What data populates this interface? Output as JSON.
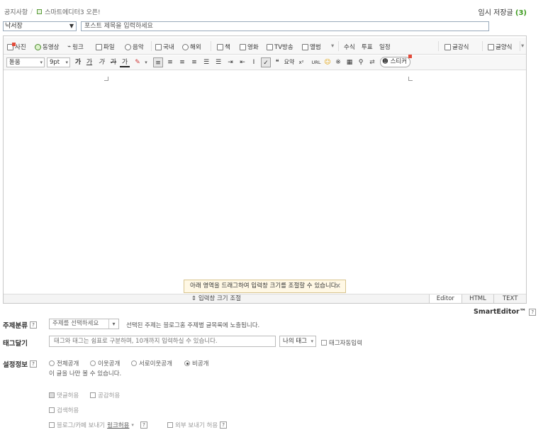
{
  "top": {
    "breadcrumb_notice": "공지사항",
    "breadcrumb_sep": "/",
    "breadcrumb_editor": "스마트에디터3 오픈!",
    "temp_saved_label": "임시 저장글",
    "temp_saved_count": "(3)"
  },
  "post": {
    "category_value": "낙서장",
    "title_placeholder": "포스트 제목을 입력하세요"
  },
  "toolbar1": {
    "photo": "사진",
    "video": "동영상",
    "link": "링크",
    "file": "파일",
    "music": "음악",
    "domestic": "국내",
    "overseas": "해외",
    "book": "책",
    "movie": "영화",
    "tv": "TV방송",
    "album": "앨범",
    "formula": "수식",
    "vote": "투표",
    "schedule": "일정",
    "article_style": "글강식",
    "form_style": "글양식"
  },
  "toolbar2": {
    "font": "돋움",
    "size": "9pt",
    "bold": "가",
    "underline": "가",
    "italic": "가",
    "strike": "가",
    "color": "가",
    "quote_label": "요약",
    "url_label": "URL",
    "sticker": "스티커"
  },
  "editor": {
    "tooltip": "아래 영역을 드래그하여 입력창 크기를 조절할 수 있습니다.",
    "resize_label": "입력창 크기 조절",
    "tabs": [
      "Editor",
      "HTML",
      "TEXT"
    ],
    "brand": "SmartEditor™"
  },
  "meta": {
    "topic_label": "주제분류",
    "topic_placeholder": "주제를 선택하세요",
    "topic_note": "선택된 주제는 블로그홈 주제별 글목록에 노출됩니다.",
    "tag_label": "태그달기",
    "tag_placeholder": "태그와 태그는 쉼표로 구분하며, 10개까지 입력하실 수 있습니다.",
    "my_tags": "나의 태그",
    "auto_tag": "태그자동입력",
    "settings_label": "설정정보",
    "privacy_options": [
      "전체공개",
      "이웃공개",
      "서로이웃공개",
      "비공개"
    ],
    "privacy_selected": "비공개",
    "privacy_note": "이 글을 나만 볼 수 있습니다.",
    "allow_comment": "댓글허용",
    "allow_empathy": "공감허용",
    "allow_search": "검색허용",
    "blog_cafe_send": "블로그/카페 보내기",
    "link_allow": "링크허용",
    "external_send": "외부 보내기 허용"
  },
  "colors": {
    "accent_green": "#3c9a1d",
    "new_badge": "#e34b3a",
    "tooltip_bg": "#fff8e5"
  }
}
